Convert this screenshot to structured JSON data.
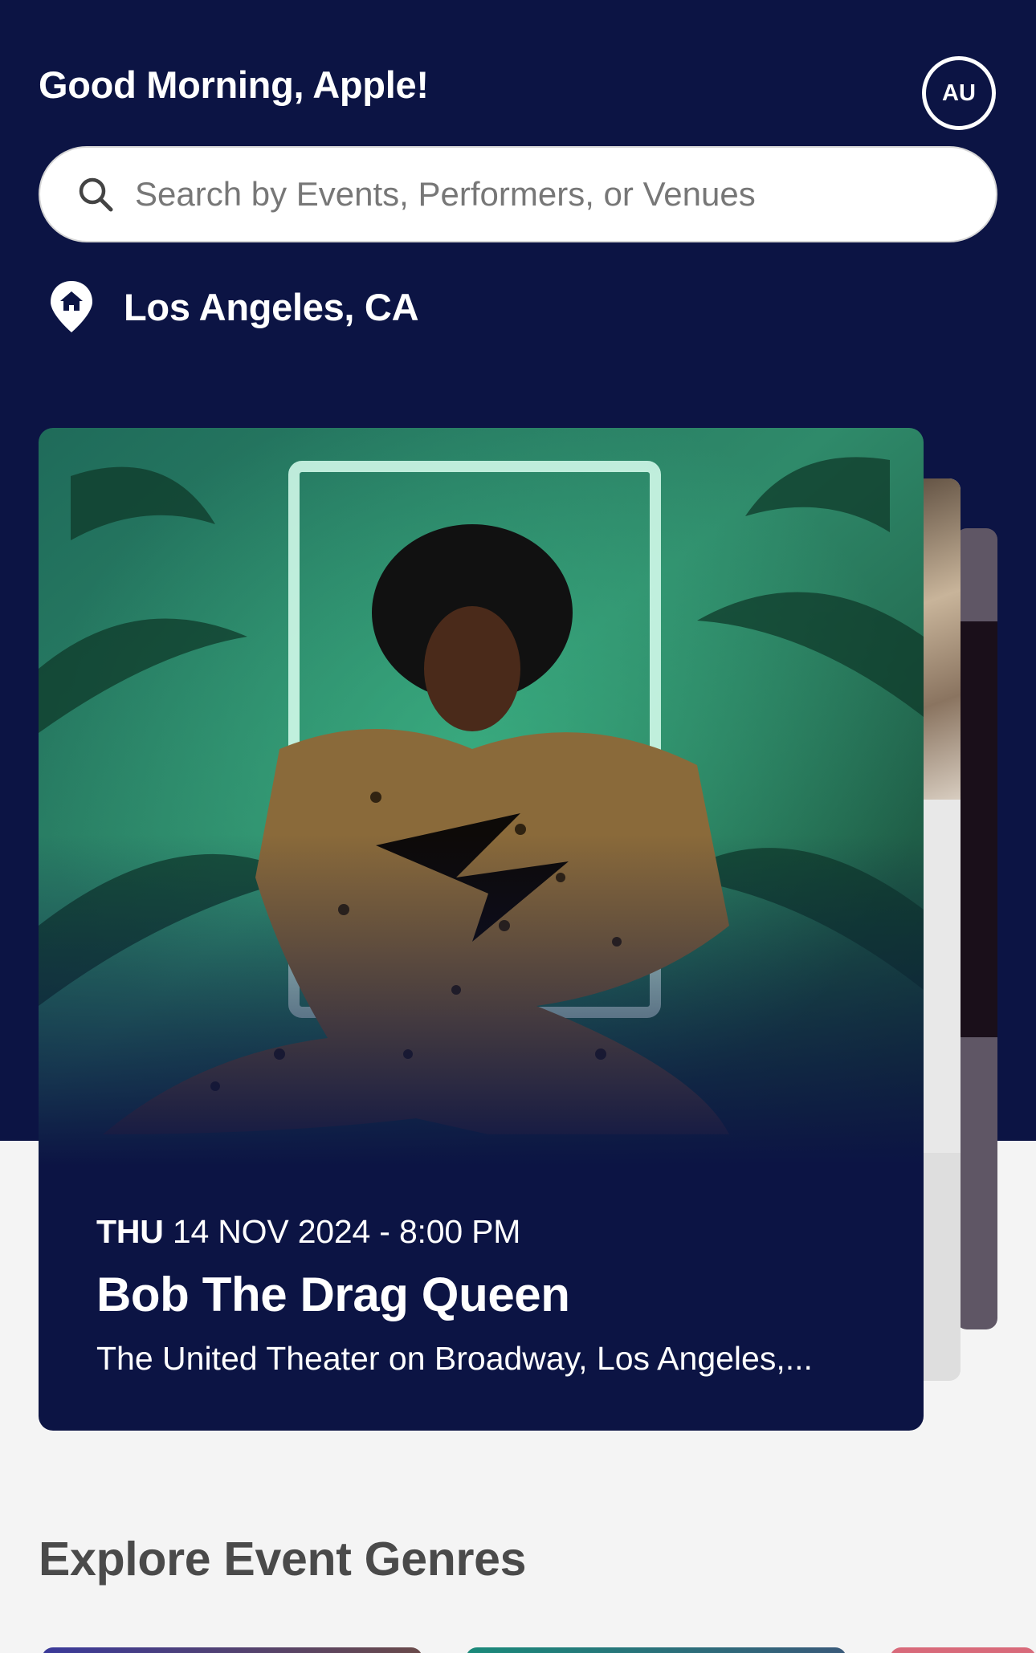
{
  "header": {
    "greeting": "Good Morning, Apple!",
    "avatar_initials": "AU"
  },
  "search": {
    "placeholder": "Search by Events, Performers, or Venues",
    "icon": "search-icon"
  },
  "location": {
    "icon": "home-location-pin-icon",
    "label": "Los Angeles, CA"
  },
  "featured_event": {
    "day": "THU",
    "date_time": " 14 NOV 2024 - 8:00 PM",
    "title": "Bob The Drag Queen",
    "venue": "The United Theater on Broadway, Los Angeles,..."
  },
  "sections": {
    "genres_title": "Explore Event Genres"
  },
  "colors": {
    "header_bg": "#0c1444",
    "page_bg": "#f4f4f4",
    "white": "#ffffff"
  }
}
